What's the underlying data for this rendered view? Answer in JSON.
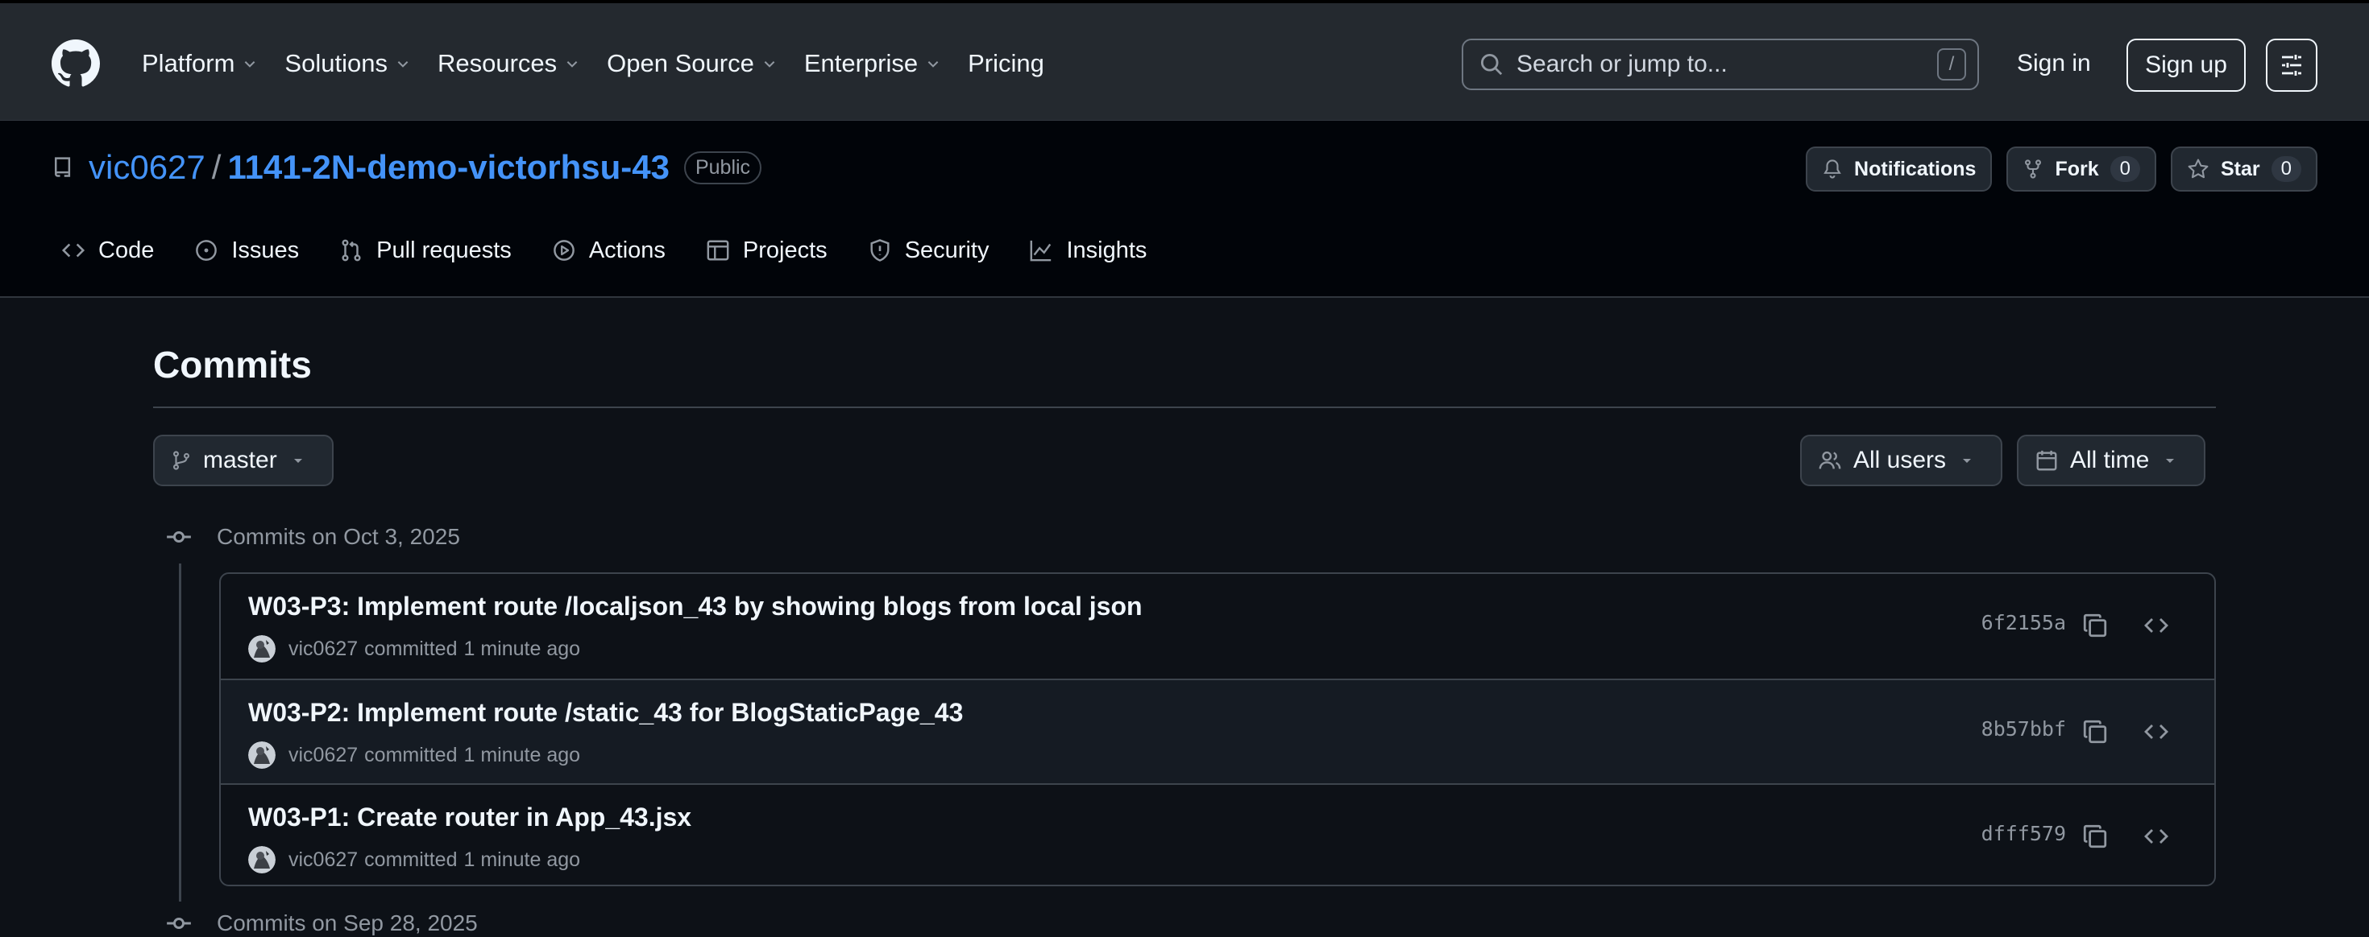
{
  "topnav": {
    "items": [
      "Platform",
      "Solutions",
      "Resources",
      "Open Source",
      "Enterprise",
      "Pricing"
    ],
    "search_placeholder": "Search or jump to...",
    "search_shortcut": "/",
    "signin": "Sign in",
    "signup": "Sign up"
  },
  "repo": {
    "owner": "vic0627",
    "separator": "/",
    "name": "1141-2N-demo-victorhsu-43",
    "visibility": "Public",
    "notifications": "Notifications",
    "fork_label": "Fork",
    "fork_count": "0",
    "star_label": "Star",
    "star_count": "0"
  },
  "tabs": [
    "Code",
    "Issues",
    "Pull requests",
    "Actions",
    "Projects",
    "Security",
    "Insights"
  ],
  "commits_page": {
    "title": "Commits",
    "branch": "master",
    "users_filter": "All users",
    "time_filter": "All time",
    "groups": [
      {
        "heading": "Commits on Oct 3, 2025",
        "commits": [
          {
            "message": "W03-P3: Implement route /localjson_43 by showing blogs from local json",
            "author": "vic0627",
            "verb": "committed",
            "time": "1 minute ago",
            "sha": "6f2155a"
          },
          {
            "message": "W03-P2: Implement route /static_43 for BlogStaticPage_43",
            "author": "vic0627",
            "verb": "committed",
            "time": "1 minute ago",
            "sha": "8b57bbf"
          },
          {
            "message": "W03-P1: Create router in App_43.jsx",
            "author": "vic0627",
            "verb": "committed",
            "time": "1 minute ago",
            "sha": "dfff579"
          }
        ]
      },
      {
        "heading": "Commits on Sep 28, 2025"
      }
    ]
  },
  "colors": {
    "background": "#0d1117",
    "header": "#24292f",
    "accent_link": "#4493f8",
    "muted_text": "#9198a1",
    "border": "#3d444d"
  }
}
